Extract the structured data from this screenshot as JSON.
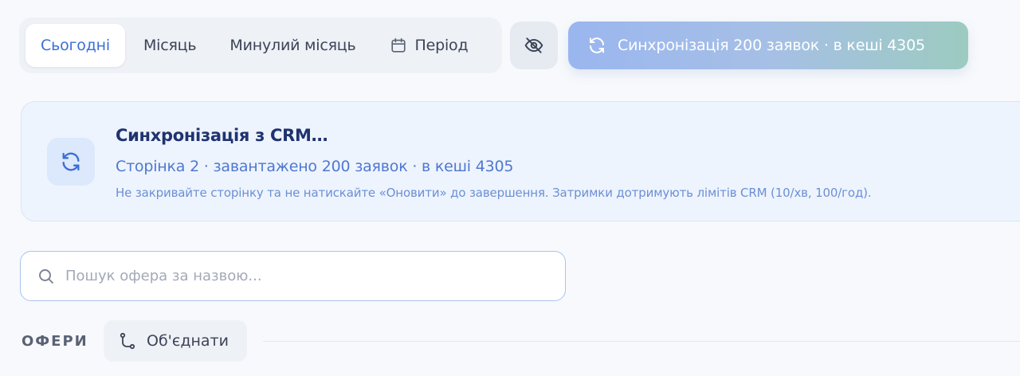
{
  "toolbar": {
    "tabs": [
      {
        "label": "Сьогодні",
        "active": true
      },
      {
        "label": "Місяць"
      },
      {
        "label": "Минулий місяць"
      },
      {
        "label": "Період",
        "icon": "calendar-icon"
      }
    ],
    "visibility_icon": "eye-off-icon",
    "sync_button": {
      "label": "Синхронізація 200 заявок · в кеші 4305",
      "icon": "refresh-icon"
    }
  },
  "sync_card": {
    "icon": "refresh-icon",
    "title": "Синхронізація з CRM…",
    "status": "Сторінка 2 · завантажено 200 заявок · в кеші 4305",
    "note": "Не закривайте сторінку та не натискайте «Оновити» до завершення. Затримки дотримують лімітів CRM (10/хв, 100/год)."
  },
  "search": {
    "placeholder": "Пошук офера за назвою...",
    "value": "",
    "icon": "search-icon"
  },
  "offers": {
    "section_label": "ОФЕРИ",
    "merge_label": "Об'єднати",
    "merge_icon": "merge-icon"
  },
  "colors": {
    "accent": "#3c6fd6",
    "card_bg": "#eef4fd",
    "title": "#1f3370",
    "gradient_start": "#9ab6ef",
    "gradient_end": "#9ccbc0"
  }
}
